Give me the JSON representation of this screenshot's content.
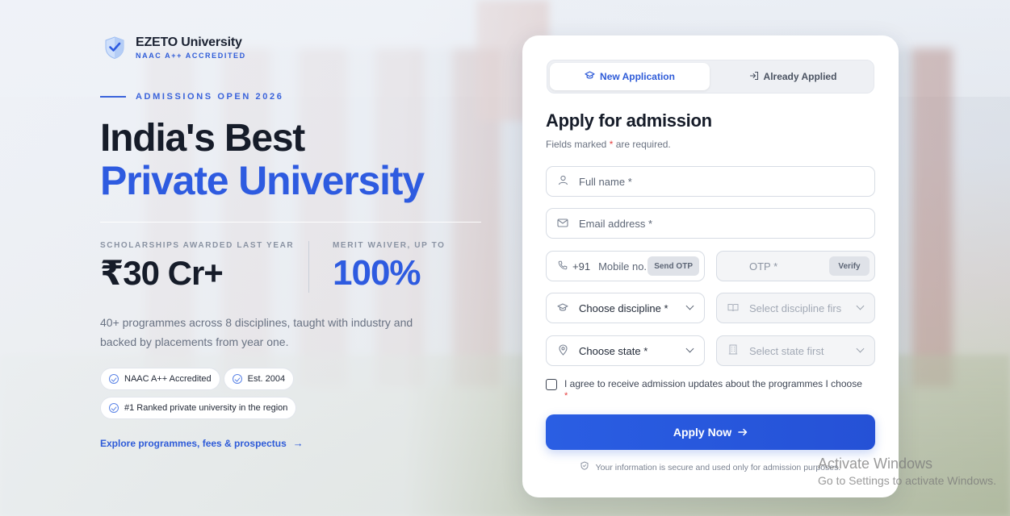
{
  "brand": {
    "name": "EZETO University",
    "accreditation": "NAAC A++ ACCREDITED",
    "logo_icon": "shield-check-icon"
  },
  "hero": {
    "eyebrow": "ADMISSIONS OPEN 2026",
    "title_line1": "India's Best",
    "title_line2": "Private University",
    "stats": [
      {
        "label": "SCHOLARSHIPS AWARDED LAST YEAR",
        "value": "₹30 Cr+"
      },
      {
        "label": "MERIT WAIVER, UP TO",
        "value": "100%"
      }
    ],
    "description": "40+ programmes across 8 disciplines, taught with industry and backed by placements from year one.",
    "chips": [
      "NAAC A++ Accredited",
      "Est. 2004",
      "#1 Ranked private university in the region"
    ],
    "explore_link": "Explore programmes, fees & prospectus"
  },
  "form": {
    "tabs": [
      {
        "label": "New Application",
        "icon": "graduation-cap-icon",
        "active": true
      },
      {
        "label": "Already Applied",
        "icon": "sign-in-icon",
        "active": false
      }
    ],
    "title": "Apply for admission",
    "subtitle_before": "Fields marked",
    "subtitle_star": "*",
    "subtitle_after": "are required.",
    "full_name_placeholder": "Full name *",
    "email_placeholder": "Email address *",
    "country_code": "+91",
    "mobile_placeholder": "Mobile no.",
    "send_otp": "Send OTP",
    "otp_placeholder": "OTP *",
    "verify": "Verify",
    "discipline": "Choose discipline *",
    "discipline_dependent": "Select discipline firs",
    "state": "Choose state *",
    "state_dependent": "Select state first",
    "agree_text": "I agree to receive admission updates about the programmes I choose",
    "agree_star": "*",
    "apply_button": "Apply Now",
    "secure_note": "Your information is secure and used only for admission purposes."
  },
  "watermark": {
    "line1": "Activate Windows",
    "line2": "Go to Settings to activate Windows."
  },
  "colors": {
    "accent": "#2e5be0",
    "heading": "#161c29",
    "required": "#e53d3d"
  }
}
